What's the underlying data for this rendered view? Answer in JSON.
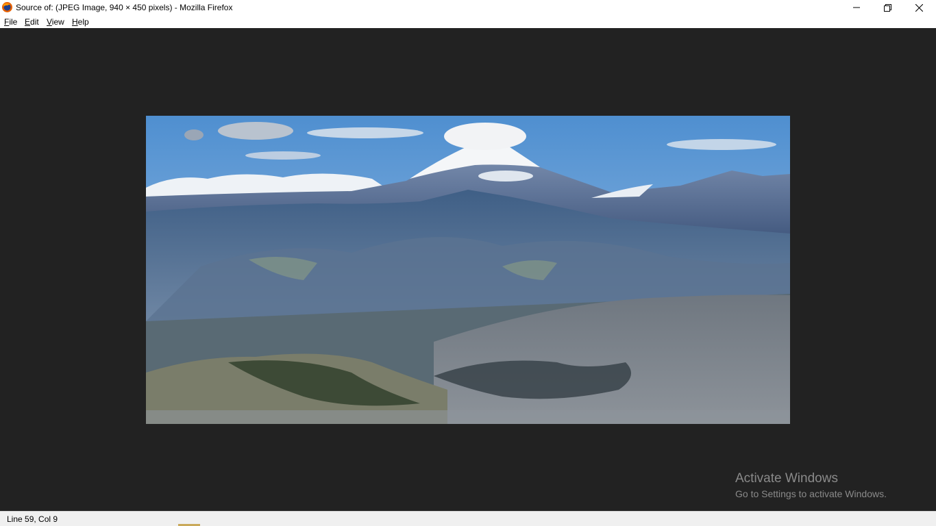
{
  "window": {
    "title": "Source of: (JPEG Image, 940 × 450 pixels) - Mozilla Firefox",
    "app_icon": "firefox-icon",
    "controls": [
      "minimize-icon",
      "restore-icon",
      "close-icon"
    ]
  },
  "menu": {
    "items": [
      {
        "label_rest": "ile",
        "accel": "F"
      },
      {
        "label_rest": "dit",
        "accel": "E"
      },
      {
        "label_rest": "iew",
        "accel": "V"
      },
      {
        "label_rest": "elp",
        "accel": "H"
      }
    ]
  },
  "image": {
    "description_alt": "JPEG Image, 940 × 450 pixels"
  },
  "watermark": {
    "line1": "Activate Windows",
    "line2": "Go to Settings to activate Windows."
  },
  "status": {
    "text": "Line 59, Col 9"
  },
  "colors": {
    "viewer_background": "#222222",
    "watermark_text": "#8a8a8a"
  }
}
